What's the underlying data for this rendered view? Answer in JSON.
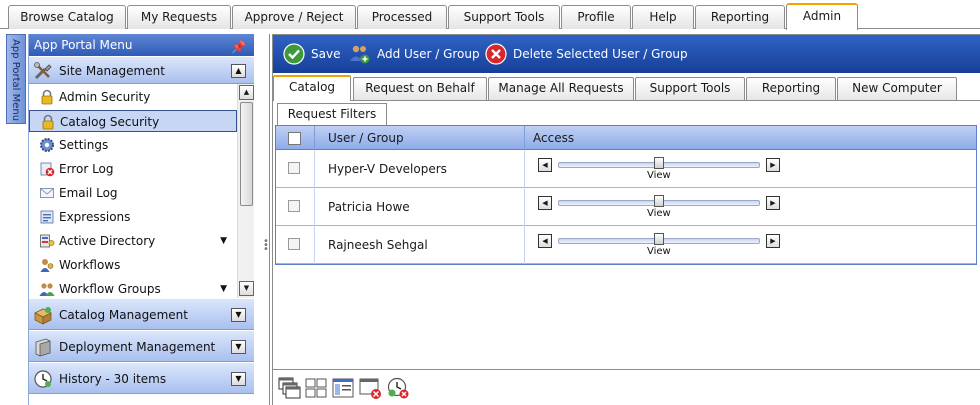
{
  "top_tabs": [
    {
      "label": "Browse Catalog"
    },
    {
      "label": "My Requests"
    },
    {
      "label": "Approve / Reject"
    },
    {
      "label": "Processed"
    },
    {
      "label": "Support Tools"
    },
    {
      "label": "Profile"
    },
    {
      "label": "Help"
    },
    {
      "label": "Reporting"
    },
    {
      "label": "Admin"
    }
  ],
  "active_top_tab": "Admin",
  "side_strip": {
    "label": "App Portal Menu"
  },
  "menu": {
    "title": "App Portal Menu",
    "site_management": {
      "label": "Site Management",
      "items": [
        {
          "label": "Admin Security",
          "icon": "lock-icon"
        },
        {
          "label": "Catalog Security",
          "icon": "lock-icon",
          "selected": true
        },
        {
          "label": "Settings",
          "icon": "gear-icon"
        },
        {
          "label": "Error Log",
          "icon": "error-log-icon"
        },
        {
          "label": "Email Log",
          "icon": "email-icon"
        },
        {
          "label": "Expressions",
          "icon": "expressions-icon"
        },
        {
          "label": "Active Directory",
          "icon": "directory-icon"
        },
        {
          "label": "Workflows",
          "icon": "workflow-icon"
        },
        {
          "label": "Workflow Groups",
          "icon": "workflow-groups-icon"
        }
      ]
    },
    "groups": [
      {
        "label": "Catalog Management",
        "icon": "package-icon"
      },
      {
        "label": "Deployment Management",
        "icon": "server-icon"
      },
      {
        "label": "History - 30 items",
        "icon": "history-clock-icon"
      }
    ]
  },
  "toolbar": {
    "save_label": "Save",
    "add_label": "Add User / Group",
    "delete_label": "Delete Selected User / Group"
  },
  "sub_tabs": [
    {
      "label": "Catalog"
    },
    {
      "label": "Request on Behalf"
    },
    {
      "label": "Manage All Requests"
    },
    {
      "label": "Support Tools"
    },
    {
      "label": "Reporting"
    },
    {
      "label": "New Computer"
    }
  ],
  "active_sub_tab": "Catalog",
  "filter_tab": {
    "label": "Request Filters"
  },
  "grid": {
    "columns": [
      "User / Group",
      "Access"
    ],
    "rows": [
      {
        "name": "Hyper-V Developers",
        "access": "View",
        "level": 0.5
      },
      {
        "name": "Patricia Howe",
        "access": "View",
        "level": 0.5
      },
      {
        "name": "Rajneesh Sehgal",
        "access": "View",
        "level": 0.5
      }
    ]
  },
  "colors": {
    "toolbar_blue": "#1f4fae",
    "menu_header_blue": "#2f5bb7",
    "active_tab_accent": "#f2a300",
    "selected_item": "#c7d6f5"
  }
}
